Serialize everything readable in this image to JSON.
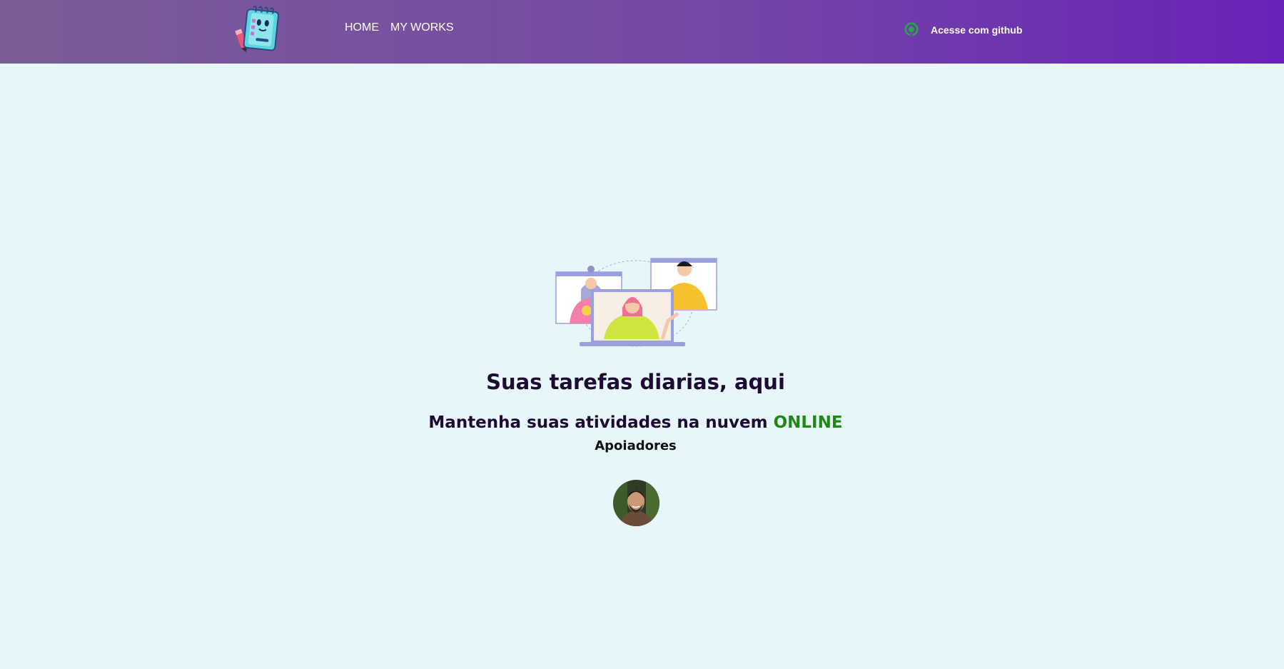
{
  "header": {
    "logo_icon": "notepad-checklist-mascot-icon",
    "nav": [
      {
        "label": "HOME"
      },
      {
        "label": "MY WORKS"
      }
    ],
    "github_button": {
      "label": "Acesse com github",
      "icon": "github-icon"
    }
  },
  "hero": {
    "illustration": "video-call-people-illustration",
    "title": "Suas tarefas diarias, aqui",
    "subtitle_main": "Mantenha suas atividades na nuvem",
    "subtitle_accent": "ONLINE",
    "supporters_heading": "Apoiadores"
  },
  "supporters": [
    {
      "avatar": "supporter-avatar-photo"
    }
  ],
  "colors": {
    "page_background": "#e6f6f9",
    "header_gradient_start": "#7b5d96",
    "header_gradient_end": "#6a22b8",
    "title_text": "#1e0b33",
    "accent_green": "#1f8a12",
    "github_icon": "#2aa34a"
  }
}
